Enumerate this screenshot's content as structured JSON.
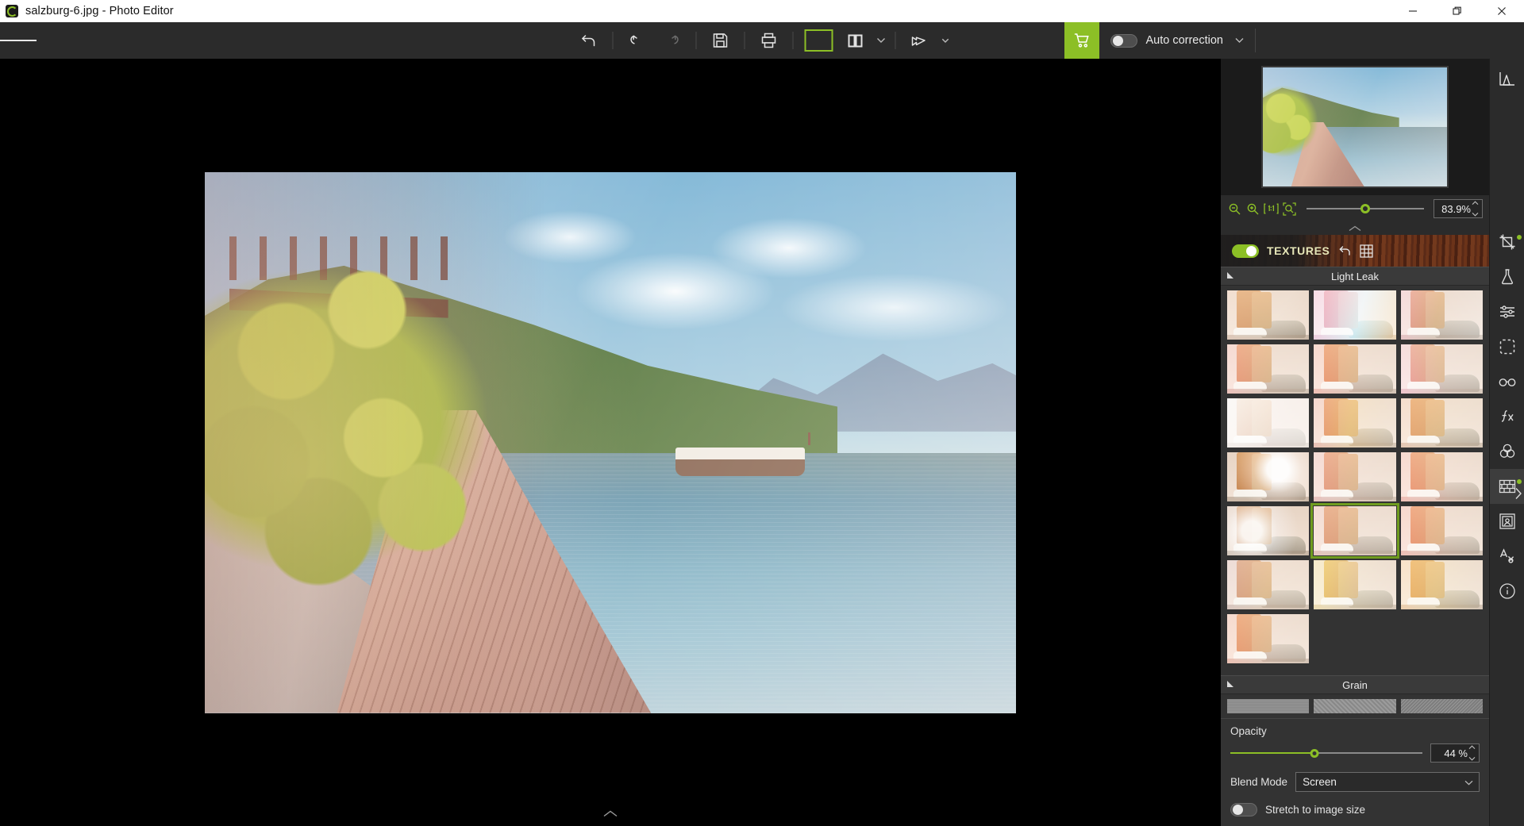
{
  "window": {
    "title": "salzburg-6.jpg - Photo Editor",
    "app_icon": "photo-editor-logo-icon",
    "controls": {
      "minimize": "minimize-icon",
      "maximize": "restore-icon",
      "close": "close-icon"
    }
  },
  "toolbar": {
    "menu_icon": "hamburger-menu-icon",
    "items": [
      {
        "name": "revert-button",
        "icon": "revert-arrow-icon",
        "enabled": true
      },
      {
        "name": "undo-button",
        "icon": "undo-arrow-icon",
        "enabled": true
      },
      {
        "name": "redo-button",
        "icon": "redo-arrow-icon",
        "enabled": false
      },
      {
        "name": "save-button",
        "icon": "floppy-disk-icon",
        "enabled": true
      },
      {
        "name": "print-button",
        "icon": "printer-icon",
        "enabled": true
      },
      {
        "name": "single-view-button",
        "icon": "single-pane-icon",
        "enabled": true,
        "active": true
      },
      {
        "name": "split-view-button",
        "icon": "split-pane-icon",
        "enabled": true
      },
      {
        "name": "view-dropdown",
        "icon": "chevron-down-icon",
        "enabled": true
      },
      {
        "name": "share-button",
        "icon": "share-arrow-icon",
        "enabled": true
      }
    ],
    "cart_label": "shopping-cart-icon",
    "auto_correction": {
      "label": "Auto correction",
      "enabled": false,
      "dropdown_icon": "chevron-down-icon"
    }
  },
  "navigator": {
    "zoom_value": "83.9%",
    "zoom_slider_percent": 50,
    "buttons": [
      {
        "name": "zoom-out-button",
        "icon": "magnifier-minus-icon"
      },
      {
        "name": "zoom-in-button",
        "icon": "magnifier-plus-icon"
      },
      {
        "name": "actual-size-button",
        "icon": "one-to-one-icon"
      },
      {
        "name": "fit-to-screen-button",
        "icon": "fit-screen-icon"
      }
    ],
    "collapse_icon": "chevron-up-icon"
  },
  "textures_panel": {
    "enabled": true,
    "title": "TEXTURES",
    "reset_icon": "reset-arrow-icon",
    "grid_icon": "grid-view-icon",
    "sections": [
      {
        "name": "light-leak",
        "title": "Light Leak",
        "collapse_icon": "collapse-triangle-icon",
        "selected_index": 13,
        "thumbnails": [
          {
            "id": 0,
            "overlay": "linear-gradient(120deg, rgba(255,140,120,.45), rgba(255,220,190,.25) 60%, rgba(255,255,255,0))"
          },
          {
            "id": 1,
            "overlay": "linear-gradient(105deg, rgba(255,60,190,.75) 0%, rgba(120,230,255,.85) 55%, rgba(255,160,60,.6) 100%)"
          },
          {
            "id": 2,
            "overlay": "linear-gradient(100deg, rgba(255,70,170,.6) 0%, rgba(255,220,220,.25) 45%, rgba(190,210,230,.4) 100%)"
          },
          {
            "id": 3,
            "overlay": "linear-gradient(95deg, rgba(255,50,90,.65) 0%, rgba(255,190,180,.3) 55%, rgba(255,240,235,.2) 100%)"
          },
          {
            "id": 4,
            "overlay": "linear-gradient(90deg, rgba(255,40,60,.7) 0%, rgba(255,170,160,.35) 50%, rgba(255,235,225,.2) 100%)"
          },
          {
            "id": 5,
            "overlay": "linear-gradient(80deg, rgba(255,70,160,.7) 0%, rgba(255,200,210,.35) 50%, rgba(235,240,250,.25) 100%)"
          },
          {
            "id": 6,
            "overlay": "linear-gradient(120deg, rgba(255,255,255,.85), rgba(255,240,245,.7) 60%, rgba(255,255,255,.6))"
          },
          {
            "id": 7,
            "overlay": "linear-gradient(100deg, rgba(255,30,80,.6) 0%, rgba(255,160,60,.5) 45%, rgba(255,235,200,.25) 100%)"
          },
          {
            "id": 8,
            "overlay": "linear-gradient(110deg, rgba(255,90,60,.6) 0%, rgba(255,200,140,.35) 55%, rgba(255,240,220,.2) 100%)"
          },
          {
            "id": 9,
            "overlay": "radial-gradient(circle at 62% 35%, rgba(255,255,255,.95) 0 18%, rgba(255,200,190,.45) 40%, rgba(255,255,255,0) 72%)"
          },
          {
            "id": 10,
            "overlay": "linear-gradient(95deg, rgba(255,60,120,.6) 0%, rgba(255,170,170,.35) 50%, rgba(255,230,230,.2) 100%)"
          },
          {
            "id": 11,
            "overlay": "linear-gradient(85deg, rgba(255,40,70,.7) 0%, rgba(255,150,140,.4) 55%, rgba(255,225,215,.2) 100%)"
          },
          {
            "id": 12,
            "overlay": "radial-gradient(circle at 30% 50%, rgba(255,255,255,.9) 0 16%, rgba(200,215,235,.4) 42%, rgba(255,255,255,0) 75%)"
          },
          {
            "id": 13,
            "overlay": "linear-gradient(100deg, rgba(255,80,120,.55) 0%, rgba(255,190,190,.3) 50%, rgba(255,240,240,.2) 100%)"
          },
          {
            "id": 14,
            "overlay": "linear-gradient(95deg, rgba(255,30,60,.7) 0%, rgba(255,160,150,.35) 55%, rgba(250,240,235,.2) 100%)"
          },
          {
            "id": 15,
            "overlay": "linear-gradient(110deg, rgba(120,90,160,.5) 0%, rgba(255,200,170,.35) 50%, rgba(255,240,225,.2) 100%)"
          },
          {
            "id": 16,
            "overlay": "linear-gradient(100deg, rgba(255,200,40,.7) 0%, rgba(255,230,160,.4) 50%, rgba(255,250,230,.2) 100%)"
          },
          {
            "id": 17,
            "overlay": "linear-gradient(100deg, rgba(255,120,30,.7) 0%, rgba(255,200,90,.45) 45%, rgba(255,245,225,.2) 100%)"
          },
          {
            "id": 18,
            "overlay": "linear-gradient(95deg, rgba(255,50,60,.65) 0%, rgba(255,180,170,.35) 55%, rgba(255,235,230,.2) 100%)"
          }
        ]
      },
      {
        "name": "grain",
        "title": "Grain",
        "collapse_icon": "collapse-triangle-icon",
        "thumbnails": [
          {
            "id": 0
          },
          {
            "id": 1
          },
          {
            "id": 2
          }
        ]
      }
    ],
    "controls": {
      "opacity_label": "Opacity",
      "opacity_value": "44 %",
      "opacity_percent": 44,
      "blend_mode_label": "Blend Mode",
      "blend_mode_value": "Screen",
      "blend_mode_chevron": "chevron-down-icon",
      "stretch_label": "Stretch to image size",
      "stretch_enabled": false
    }
  },
  "side_tools": {
    "histogram_icon": "histogram-icon",
    "expand_icon": "chevron-right-icon",
    "items": [
      {
        "name": "crop-tool",
        "icon": "crop-icon",
        "badge": true,
        "selected": false
      },
      {
        "name": "enhance-tool",
        "icon": "flask-icon",
        "badge": false,
        "selected": false
      },
      {
        "name": "adjust-tool",
        "icon": "sliders-icon",
        "badge": false,
        "selected": false
      },
      {
        "name": "selection-tool",
        "icon": "dashed-square-icon",
        "badge": false,
        "selected": false
      },
      {
        "name": "retouch-tool",
        "icon": "glasses-icon",
        "badge": false,
        "selected": false
      },
      {
        "name": "effects-tool",
        "icon": "fx-icon",
        "badge": false,
        "selected": false
      },
      {
        "name": "color-tool",
        "icon": "venn-circles-icon",
        "badge": false,
        "selected": false
      },
      {
        "name": "textures-tool",
        "icon": "brick-wall-icon",
        "badge": true,
        "selected": true
      },
      {
        "name": "frames-tool",
        "icon": "portrait-frame-icon",
        "badge": false,
        "selected": false
      },
      {
        "name": "text-tool",
        "icon": "text-effects-icon",
        "badge": false,
        "selected": false
      },
      {
        "name": "info-tool",
        "icon": "info-circle-icon",
        "badge": false,
        "selected": false
      }
    ]
  },
  "canvas": {
    "image_name": "salzburg-6.jpg",
    "collapse_icon": "chevron-up-icon"
  },
  "colors": {
    "accent_green": "#8cbf26",
    "panel_bg": "#333333",
    "toolbar_bg": "#2b2b2b",
    "canvas_bg": "#000000"
  }
}
